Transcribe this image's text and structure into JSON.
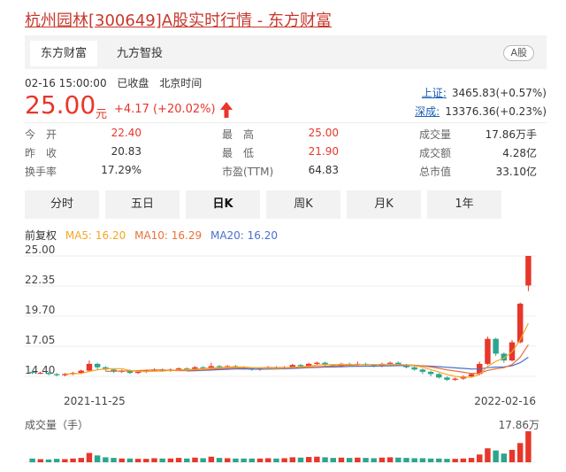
{
  "page_title": "杭州园林[300649]A股实时行情 - 东方财富",
  "tabs": [
    {
      "label": "东方财富",
      "active": true
    },
    {
      "label": "九方智投",
      "active": false
    }
  ],
  "market_badge": "A股",
  "quote": {
    "datetime": "02-16 15:00:00",
    "status": "已收盘",
    "timezone": "北京时间",
    "price": "25.00",
    "unit": "元",
    "change": "+4.17",
    "change_pct": "(+20.02%)",
    "up_color": "#e8362a"
  },
  "indices": [
    {
      "label": "上证:",
      "value": "3465.83(+0.57%)"
    },
    {
      "label": "深成:",
      "value": "13376.36(+0.23%)"
    }
  ],
  "stats": {
    "row1": [
      {
        "label": "今　开",
        "value": "22.40",
        "red": true
      },
      {
        "label": "最　高",
        "value": "25.00",
        "red": true
      },
      {
        "label": "成交量",
        "value": "17.86万手",
        "red": false
      }
    ],
    "row2": [
      {
        "label": "昨　收",
        "value": "20.83",
        "red": false
      },
      {
        "label": "最　低",
        "value": "21.90",
        "red": true
      },
      {
        "label": "成交额",
        "value": "4.28亿",
        "red": false
      }
    ],
    "row3": [
      {
        "label": "换手率",
        "value": "17.29%",
        "red": false
      },
      {
        "label": "市盈(TTM)",
        "value": "64.83",
        "red": false
      },
      {
        "label": "总市值",
        "value": "33.10亿",
        "red": false
      }
    ]
  },
  "period_buttons": [
    {
      "label": "分时",
      "active": false
    },
    {
      "label": "五日",
      "active": false
    },
    {
      "label": "日K",
      "active": true
    },
    {
      "label": "周K",
      "active": false
    },
    {
      "label": "月K",
      "active": false
    },
    {
      "label": "1年",
      "active": false
    }
  ],
  "ma_legend": {
    "adjust": "前复权",
    "ma5": "MA5: 16.20",
    "ma10": "MA10: 16.29",
    "ma20": "MA20: 16.20",
    "ma5_color": "#f5a623",
    "ma10_color": "#e8703a",
    "ma20_color": "#4a6fd1"
  },
  "volume_legend": {
    "title": "成交量（手）",
    "max": "17.86万"
  },
  "chart_data": {
    "type": "candlestick",
    "y_ticks": [
      "25.00",
      "22.35",
      "19.70",
      "17.05",
      "14.40"
    ],
    "ylim": [
      14.4,
      25.0
    ],
    "x_ticks": [
      "2021-11-25",
      "2022-02-16"
    ],
    "up_color": "#e8362a",
    "down_color": "#2ca58d",
    "candles": [
      [
        14.8,
        14.7,
        14.9,
        14.6,
        0.12
      ],
      [
        14.7,
        14.7,
        14.8,
        14.6,
        0.1
      ],
      [
        14.7,
        14.6,
        14.8,
        14.5,
        0.09
      ],
      [
        14.6,
        14.5,
        14.7,
        14.4,
        0.11
      ],
      [
        14.5,
        14.6,
        14.7,
        14.4,
        0.1
      ],
      [
        14.6,
        14.7,
        14.8,
        14.5,
        0.12
      ],
      [
        14.7,
        14.9,
        15.0,
        14.6,
        0.14
      ],
      [
        14.9,
        15.5,
        15.8,
        14.8,
        0.3
      ],
      [
        15.5,
        15.2,
        15.6,
        15.0,
        0.22
      ],
      [
        15.2,
        15.0,
        15.3,
        14.9,
        0.16
      ],
      [
        15.0,
        14.8,
        15.1,
        14.7,
        0.14
      ],
      [
        14.8,
        14.9,
        15.0,
        14.7,
        0.12
      ],
      [
        14.9,
        14.7,
        15.0,
        14.6,
        0.12
      ],
      [
        14.7,
        14.8,
        14.9,
        14.6,
        0.11
      ],
      [
        14.8,
        14.9,
        15.0,
        14.7,
        0.11
      ],
      [
        14.9,
        15.0,
        15.1,
        14.8,
        0.13
      ],
      [
        15.0,
        14.9,
        15.1,
        14.8,
        0.12
      ],
      [
        14.9,
        15.0,
        15.1,
        14.8,
        0.12
      ],
      [
        15.0,
        15.1,
        15.2,
        14.9,
        0.14
      ],
      [
        15.1,
        15.0,
        15.2,
        14.9,
        0.12
      ],
      [
        15.0,
        15.2,
        15.3,
        14.9,
        0.15
      ],
      [
        15.2,
        15.1,
        15.3,
        15.0,
        0.13
      ],
      [
        15.1,
        15.3,
        15.6,
        15.0,
        0.18
      ],
      [
        15.3,
        15.2,
        15.4,
        15.1,
        0.14
      ],
      [
        15.2,
        15.3,
        15.4,
        15.1,
        0.13
      ],
      [
        15.3,
        15.2,
        15.4,
        15.1,
        0.12
      ],
      [
        15.2,
        15.1,
        15.3,
        15.0,
        0.12
      ],
      [
        15.1,
        15.0,
        15.2,
        14.9,
        0.12
      ],
      [
        15.0,
        15.1,
        15.2,
        14.9,
        0.12
      ],
      [
        15.1,
        15.2,
        15.3,
        15.0,
        0.13
      ],
      [
        15.2,
        15.1,
        15.3,
        15.0,
        0.12
      ],
      [
        15.1,
        15.2,
        15.3,
        15.0,
        0.13
      ],
      [
        15.2,
        15.4,
        15.5,
        15.1,
        0.16
      ],
      [
        15.4,
        15.3,
        15.5,
        15.2,
        0.15
      ],
      [
        15.3,
        15.5,
        15.6,
        15.2,
        0.17
      ],
      [
        15.5,
        15.6,
        15.7,
        15.4,
        0.18
      ],
      [
        15.6,
        15.4,
        15.7,
        15.3,
        0.16
      ],
      [
        15.4,
        15.3,
        15.5,
        15.2,
        0.14
      ],
      [
        15.3,
        15.5,
        15.6,
        15.2,
        0.15
      ],
      [
        15.5,
        15.4,
        15.6,
        15.3,
        0.14
      ],
      [
        15.4,
        15.5,
        15.7,
        15.3,
        0.15
      ],
      [
        15.5,
        15.4,
        15.6,
        15.3,
        0.14
      ],
      [
        15.4,
        15.3,
        15.5,
        15.2,
        0.13
      ],
      [
        15.3,
        15.5,
        15.6,
        15.2,
        0.15
      ],
      [
        15.5,
        15.6,
        15.7,
        15.4,
        0.16
      ],
      [
        15.6,
        15.4,
        15.7,
        15.3,
        0.15
      ],
      [
        15.4,
        15.2,
        15.5,
        15.1,
        0.14
      ],
      [
        15.2,
        15.0,
        15.3,
        14.9,
        0.13
      ],
      [
        15.0,
        14.8,
        15.1,
        14.6,
        0.13
      ],
      [
        14.8,
        14.6,
        14.9,
        14.4,
        0.12
      ],
      [
        14.6,
        14.3,
        14.7,
        14.2,
        0.12
      ],
      [
        14.3,
        14.1,
        14.4,
        14.0,
        0.11
      ],
      [
        14.1,
        14.2,
        14.3,
        14.0,
        0.11
      ],
      [
        14.2,
        14.4,
        14.5,
        14.1,
        0.12
      ],
      [
        14.4,
        14.6,
        14.7,
        14.3,
        0.14
      ],
      [
        14.6,
        15.5,
        15.7,
        14.5,
        0.25
      ],
      [
        15.5,
        17.7,
        17.9,
        15.4,
        0.45
      ],
      [
        17.7,
        16.4,
        17.8,
        16.2,
        0.38
      ],
      [
        16.4,
        15.8,
        16.5,
        15.6,
        0.28
      ],
      [
        15.8,
        17.4,
        17.6,
        15.7,
        0.4
      ],
      [
        17.4,
        20.8,
        20.9,
        17.3,
        0.62
      ],
      [
        22.4,
        25.0,
        25.0,
        21.9,
        1.0
      ]
    ]
  }
}
